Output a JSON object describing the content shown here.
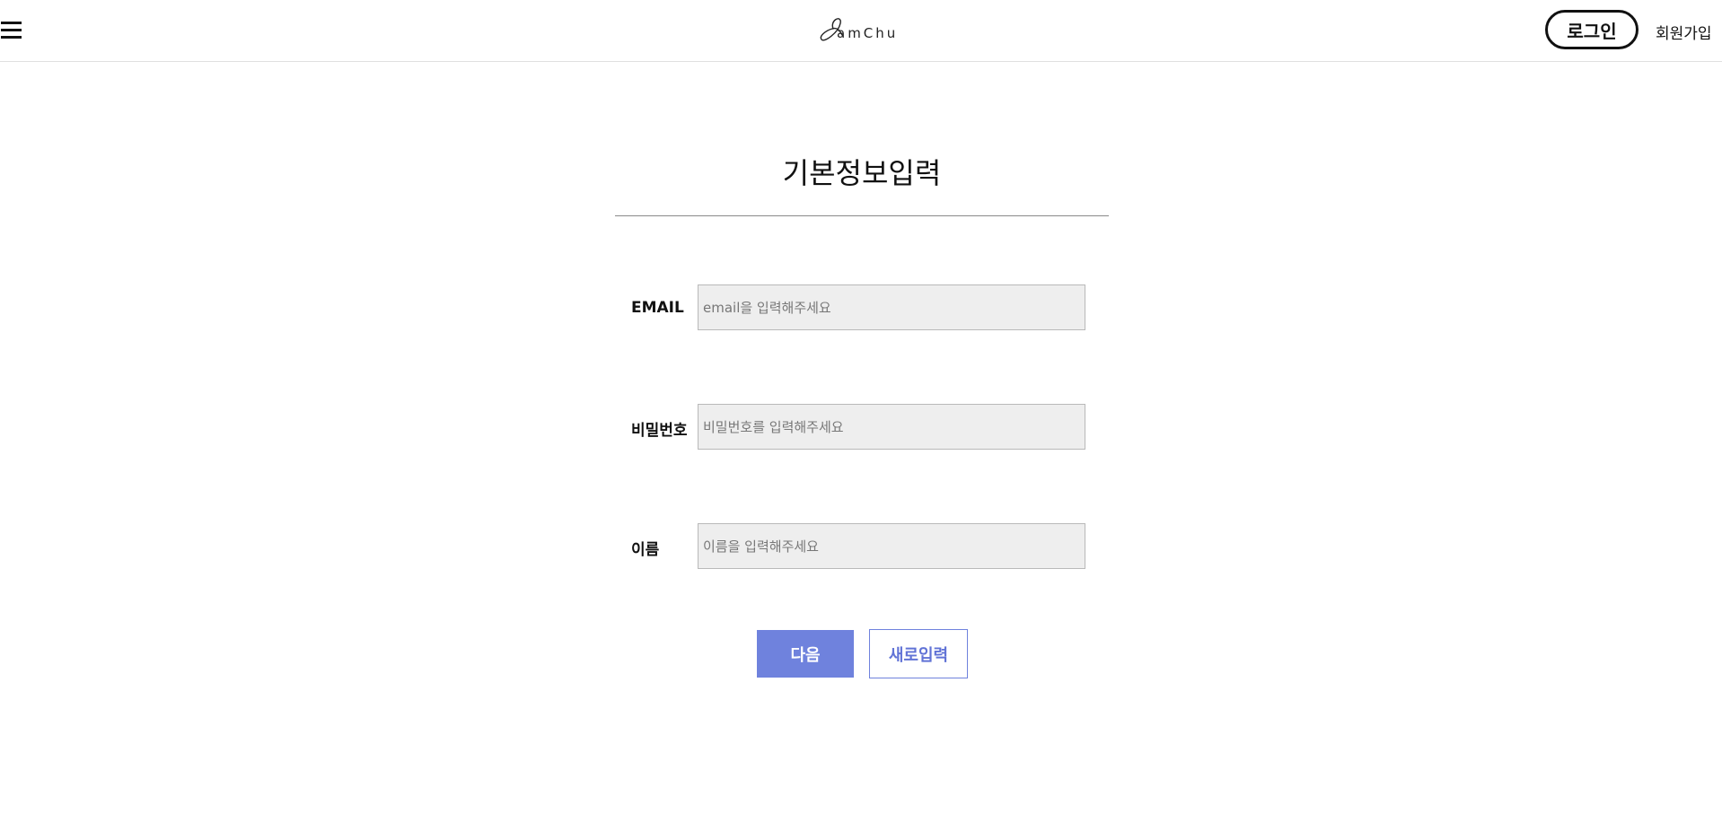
{
  "header": {
    "menu_icon": "hamburger-menu-icon",
    "logo_text": "amChu",
    "login_label": "로그인",
    "signup_label": "회원가입"
  },
  "main": {
    "title": "기본정보입력",
    "fields": [
      {
        "label": "EMAIL",
        "placeholder": "email을 입력해주세요",
        "value": ""
      },
      {
        "label": "비밀번호",
        "placeholder": "비밀번호를 입력해주세요",
        "value": ""
      },
      {
        "label": "이름",
        "placeholder": "이름을 입력해주세요",
        "value": ""
      }
    ],
    "next_label": "다음",
    "reset_label": "새로입력"
  },
  "colors": {
    "accent": "#6f82dd",
    "input_bg": "#eeeeee",
    "text": "#111111"
  }
}
